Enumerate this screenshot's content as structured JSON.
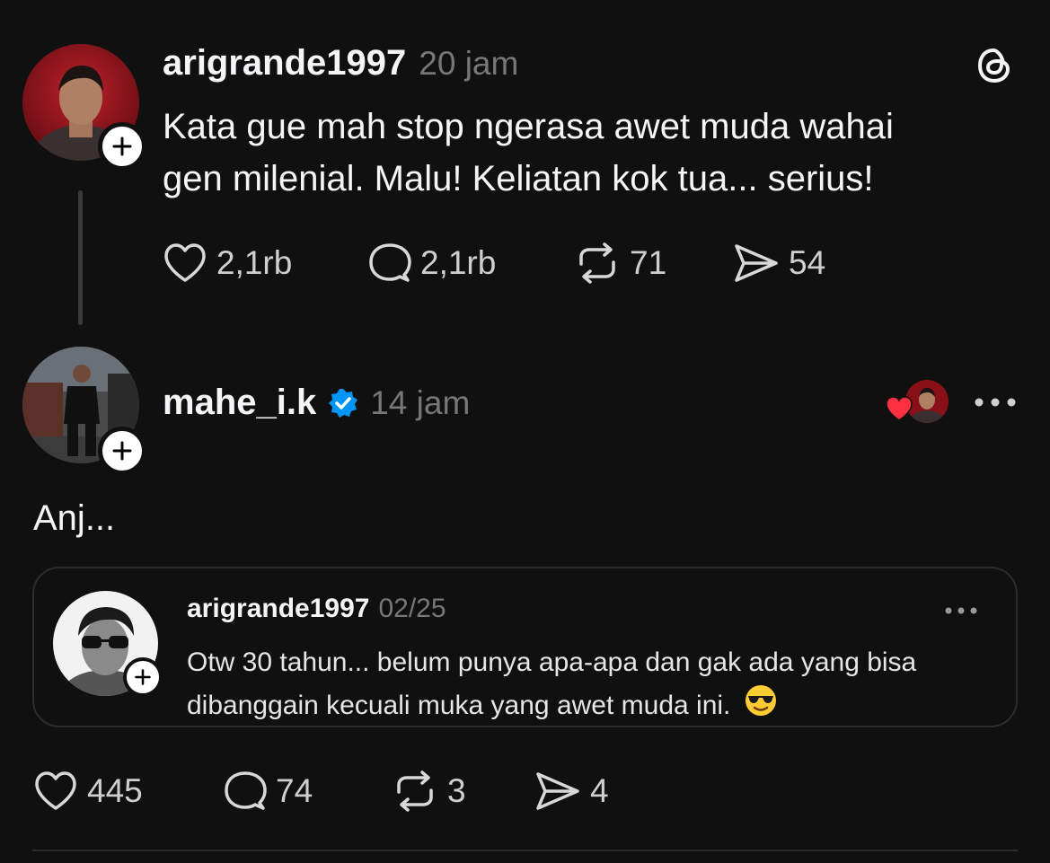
{
  "post": {
    "username": "arigrande1997",
    "time": "20 jam",
    "text_line1": "Kata gue mah stop ngerasa awet muda wahai",
    "text_line2": "gen milenial. Malu! Keliatan kok tua... serius!",
    "likes": "2,1rb",
    "replies": "2,1rb",
    "reposts": "71",
    "shares": "54"
  },
  "reply": {
    "username": "mahe_i.k",
    "verified": true,
    "time": "14 jam",
    "text": "Anj...",
    "liked_by_author": true,
    "likes": "445",
    "replies": "74",
    "reposts": "3",
    "shares": "4",
    "quote": {
      "username": "arigrande1997",
      "date": "02/25",
      "text_line1": "Otw 30 tahun... belum punya apa-apa dan gak ada yang bisa",
      "text_line2": "dibanggain kecuali muka yang awet muda ini.",
      "emoji": "😎"
    }
  },
  "colors": {
    "background": "#101010",
    "verified_blue": "#0095f6",
    "like_red": "#ff3040",
    "muted": "#777777"
  },
  "icons": [
    "threads-logo-icon",
    "heart-icon",
    "comment-icon",
    "repost-icon",
    "share-icon",
    "verified-badge-icon",
    "more-icon",
    "plus-icon"
  ]
}
